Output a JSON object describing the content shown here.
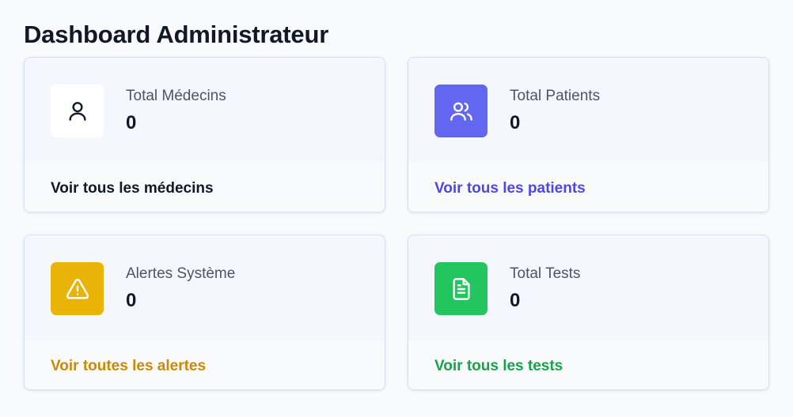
{
  "page": {
    "title": "Dashboard Administrateur"
  },
  "cards": [
    {
      "label": "Total Médecins",
      "value": "0",
      "link": "Voir tous les médecins",
      "icon": "user-icon",
      "icon_bg": "#ffffff",
      "icon_color": "#111827",
      "link_color": "#111827"
    },
    {
      "label": "Total Patients",
      "value": "0",
      "link": "Voir tous les patients",
      "icon": "users-icon",
      "icon_bg": "#6366f1",
      "icon_color": "#ffffff",
      "link_color": "#4f46e5"
    },
    {
      "label": "Alertes Système",
      "value": "0",
      "link": "Voir toutes les alertes",
      "icon": "warning-icon",
      "icon_bg": "#eab308",
      "icon_color": "#ffffff",
      "link_color": "#ca8a04"
    },
    {
      "label": "Total Tests",
      "value": "0",
      "link": "Voir tous les tests",
      "icon": "document-icon",
      "icon_bg": "#22c55e",
      "icon_color": "#ffffff",
      "link_color": "#16a34a"
    }
  ]
}
